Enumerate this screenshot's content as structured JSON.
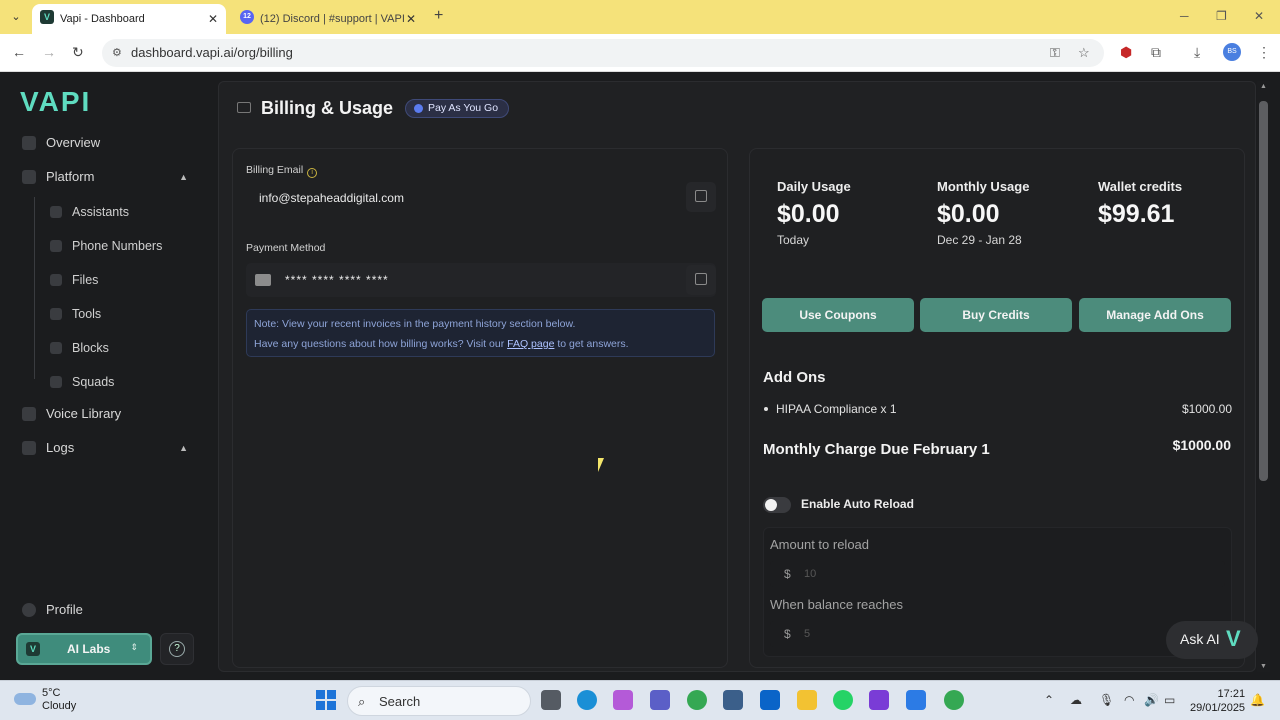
{
  "browser": {
    "tabs": [
      {
        "title": "Vapi - Dashboard",
        "favicon": "V",
        "active": true
      },
      {
        "title": "(12) Discord | #support | VAPI",
        "favicon": "12",
        "active": false
      }
    ],
    "url": "dashboard.vapi.ai/org/billing",
    "profile_initials": "BS"
  },
  "sidebar": {
    "logo": "VAPI",
    "items": [
      {
        "label": "Overview"
      },
      {
        "label": "Platform"
      },
      {
        "label": "Voice Library"
      },
      {
        "label": "Logs"
      }
    ],
    "platform_subitems": [
      {
        "label": "Assistants"
      },
      {
        "label": "Phone Numbers"
      },
      {
        "label": "Files"
      },
      {
        "label": "Tools"
      },
      {
        "label": "Blocks"
      },
      {
        "label": "Squads"
      }
    ],
    "profile_label": "Profile",
    "org": {
      "name": "AI Labs",
      "icon": "V"
    },
    "help_glyph": "?"
  },
  "page": {
    "title": "Billing & Usage",
    "plan_badge": "Pay As You Go"
  },
  "billing": {
    "email_label": "Billing Email",
    "email_value": "info@stepaheaddigital.com",
    "payment_label": "Payment Method",
    "payment_value": "**** **** **** ****",
    "note_line1": "Note: View your recent invoices in the payment history section below.",
    "note_line2_prefix": "Have any questions about how billing works? Visit our",
    "note_link": "FAQ page",
    "note_line2_suffix": "to get answers."
  },
  "usage": {
    "daily": {
      "label": "Daily Usage",
      "value": "$0.00",
      "sub": "Today"
    },
    "monthly": {
      "label": "Monthly Usage",
      "value": "$0.00",
      "sub": "Dec 29 - Jan 28"
    },
    "wallet": {
      "label": "Wallet credits",
      "value": "$99.61"
    }
  },
  "actions": {
    "use_coupons": "Use Coupons",
    "buy_credits": "Buy Credits",
    "manage_addons": "Manage Add Ons"
  },
  "addons": {
    "title": "Add Ons",
    "items": [
      {
        "name": "HIPAA Compliance x 1",
        "price": "$1000.00"
      }
    ],
    "due_label": "Monthly Charge Due February 1",
    "due_amount": "$1000.00"
  },
  "auto_reload": {
    "toggle_label": "Enable Auto Reload",
    "enabled": false,
    "amount_label": "Amount to reload",
    "amount_currency": "$",
    "amount_placeholder": "10",
    "threshold_label": "When balance reaches",
    "threshold_currency": "$",
    "threshold_placeholder": "5"
  },
  "ask_ai": {
    "label": "Ask AI",
    "glyph": "V"
  },
  "taskbar": {
    "weather_temp": "5°C",
    "weather_desc": "Cloudy",
    "search_label": "Search",
    "time": "17:21",
    "date": "29/01/2025"
  },
  "colors": {
    "accent": "#5fdcc0",
    "button": "#4c8c7c",
    "tabbar": "#f5e27a"
  }
}
